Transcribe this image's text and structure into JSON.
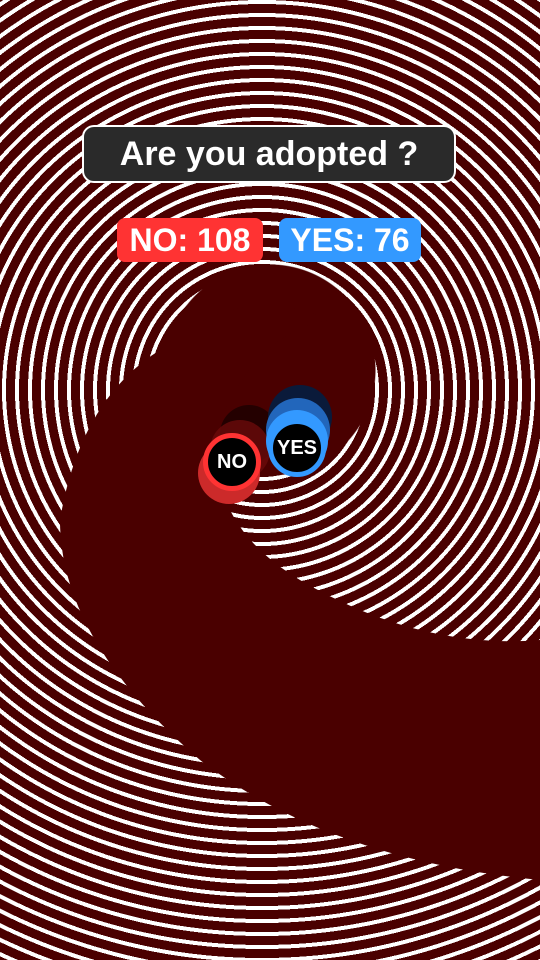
{
  "question": "Are you adopted ?",
  "scores": {
    "no_label": "NO: 108",
    "yes_label": "YES: 76"
  },
  "balls": {
    "no": "NO",
    "yes": "YES"
  },
  "colors": {
    "background": "#4a0000",
    "no": "#ff3333",
    "yes": "#3399ff",
    "stripes": "#ffffff"
  }
}
